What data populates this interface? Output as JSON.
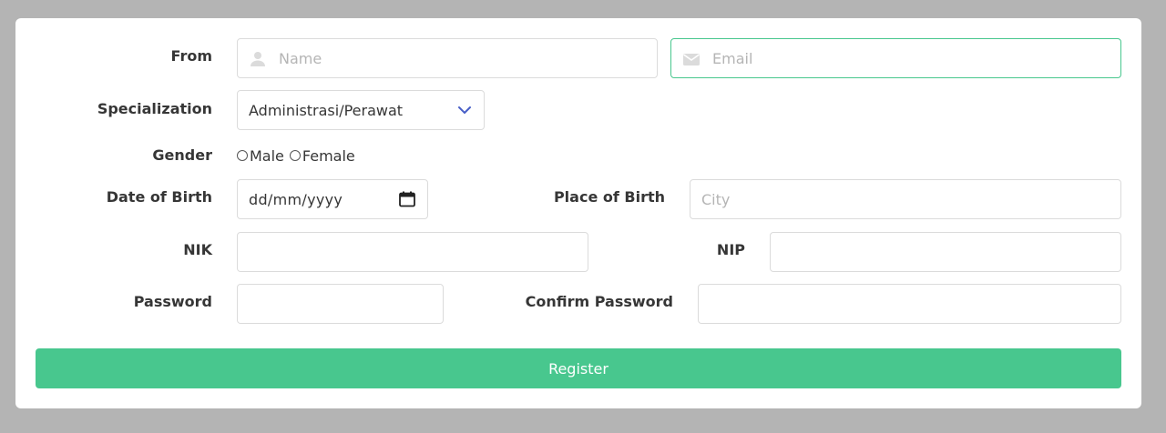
{
  "form": {
    "from_label": "From",
    "name_placeholder": "Name",
    "email_placeholder": "Email",
    "specialization_label": "Specialization",
    "specialization_value": "Administrasi/Perawat",
    "gender_label": "Gender",
    "gender_options": [
      "Male",
      "Female"
    ],
    "dob_label": "Date of Birth",
    "dob_placeholder": "dd/mm/yyyy",
    "pob_label": "Place of Birth",
    "city_placeholder": "City",
    "nik_label": "NIK",
    "nip_label": "NIP",
    "password_label": "Password",
    "confirm_password_label": "Confirm Password",
    "register_label": "Register"
  },
  "colors": {
    "accent": "#48c78e",
    "chevron": "#485fc7",
    "background": "#b4b4b4"
  }
}
